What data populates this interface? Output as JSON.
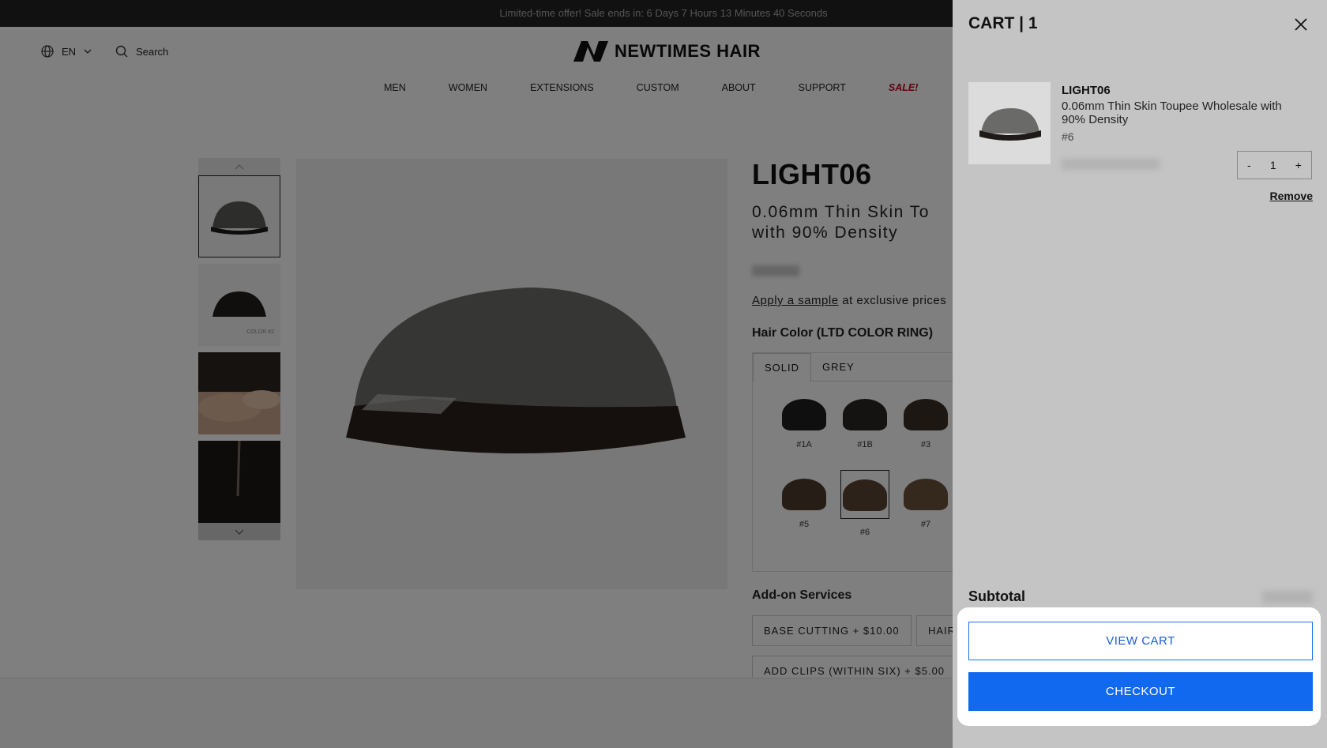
{
  "announcement": "Limited-time offer! Sale ends in: 6 Days 7 Hours 13 Minutes 40 Seconds",
  "header": {
    "language": "EN",
    "search_label": "Search",
    "logo_text": "NEWTIMES HAIR",
    "nav": [
      "MEN",
      "WOMEN",
      "EXTENSIONS",
      "CUSTOM",
      "ABOUT",
      "SUPPORT",
      "SALE!"
    ]
  },
  "product": {
    "title": "LIGHT06",
    "subtitle_line1": "0.06mm Thin Skin To",
    "subtitle_line2": "with 90% Density",
    "apply_link": "Apply a sample",
    "apply_rest": " at exclusive prices",
    "hair_color_label": "Hair Color (LTD COLOR RING)",
    "color_tabs": [
      "SOLID",
      "GREY"
    ],
    "swatches": [
      {
        "label": "#1A",
        "color": "#1e1e1e"
      },
      {
        "label": "#1B",
        "color": "#2a2622"
      },
      {
        "label": "#3",
        "color": "#3a2e26"
      },
      {
        "label": "#5",
        "color": "#4a3a2c"
      },
      {
        "label": "#6",
        "color": "#5a4432",
        "selected": true
      },
      {
        "label": "#7",
        "color": "#6a5038"
      }
    ],
    "thumb_caption": "COLOR #2",
    "addon_heading": "Add-on Services",
    "addons": [
      "BASE CUTTING + $10.00",
      "HAIR",
      "ADD CLIPS (WITHIN SIX) + $5.00"
    ]
  },
  "cart": {
    "title": "CART | 1",
    "item": {
      "name": "LIGHT06",
      "description": "0.06mm Thin Skin Toupee Wholesale with 90% Density",
      "variant": "#6",
      "quantity": "1",
      "minus": "-",
      "plus": "+"
    },
    "remove_label": "Remove",
    "subtotal_label": "Subtotal",
    "view_cart_label": "VIEW CART",
    "checkout_label": "CHECKOUT"
  },
  "colors": {
    "accent": "#1169f0",
    "sale": "#c0001a"
  }
}
